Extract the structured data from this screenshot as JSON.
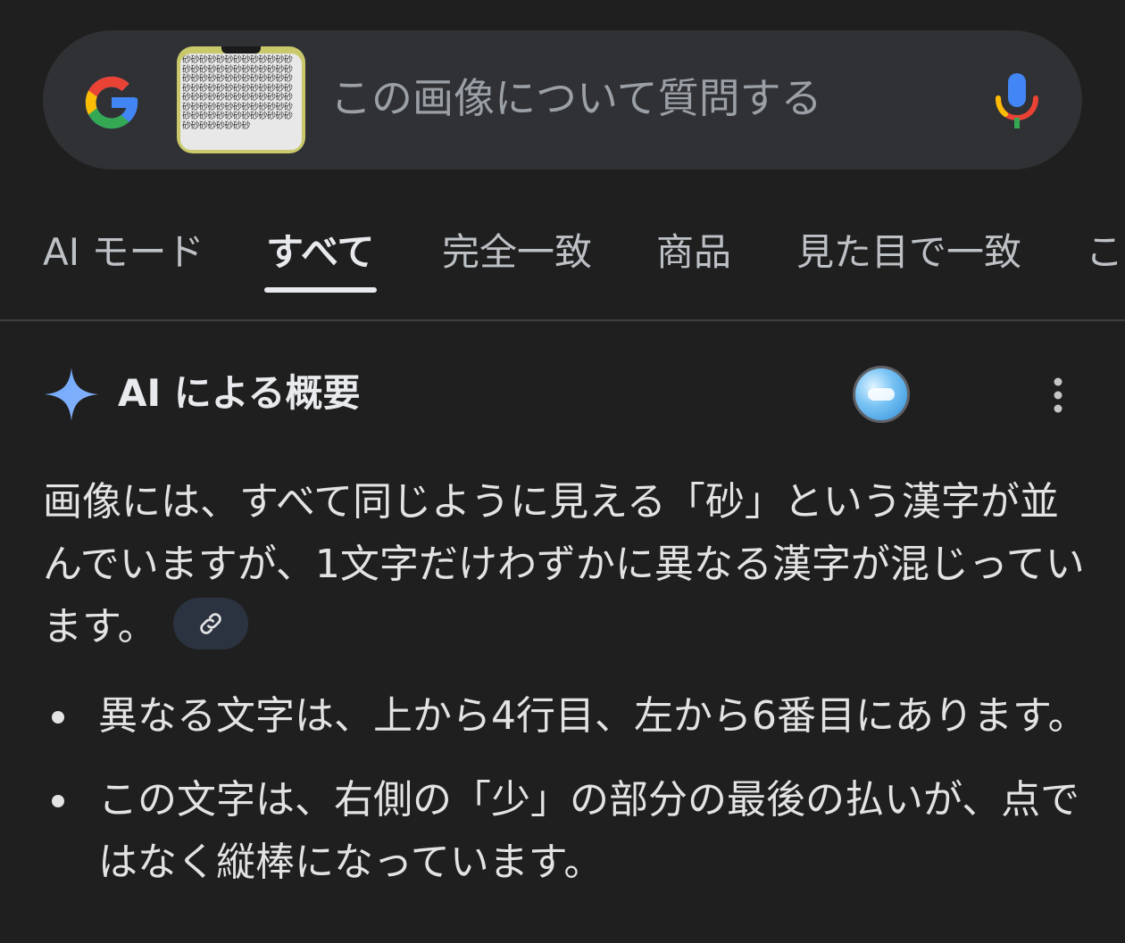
{
  "search": {
    "placeholder": "この画像について質問する",
    "thumbnail_text": "砂砂砂砂砂砂砂砂砂砂砂砂砂砂砂砂砂砂砂砂砂砂砂砂砂砂砂砂砂砂砂砂砂砂砂砂砂砂砂砂砂砂砂砂砂砂砂砂砂砂砂砂砂砂砂砂砂砂砂砂砂砂砂砂砂砂砂砂砂砂砂砂砂砂砂砂砂砂砂砂砂砂砂砂砂砂砂砂砂砂砂砂砂砂砂砂砂砂砂"
  },
  "tabs": [
    {
      "label": "AI モード"
    },
    {
      "label": "すべて"
    },
    {
      "label": "完全一致"
    },
    {
      "label": "商品"
    },
    {
      "label": "見た目で一致"
    },
    {
      "label": "こ"
    }
  ],
  "ai_overview": {
    "title": "AI による概要",
    "paragraph": "画像には、すべて同じように見える「砂」という漢字が並んでいますが、1文字だけわずかに異なる漢字が混じっています。",
    "bullets": [
      "異なる文字は、上から4行目、左から6番目にあります。",
      "この文字は、右側の「少」の部分の最後の払いが、点ではなく縦棒になっています。"
    ]
  },
  "colors": {
    "background": "#1f1f1f",
    "search_bg": "#303134",
    "accent_sparkle": "#8ab4f8"
  }
}
